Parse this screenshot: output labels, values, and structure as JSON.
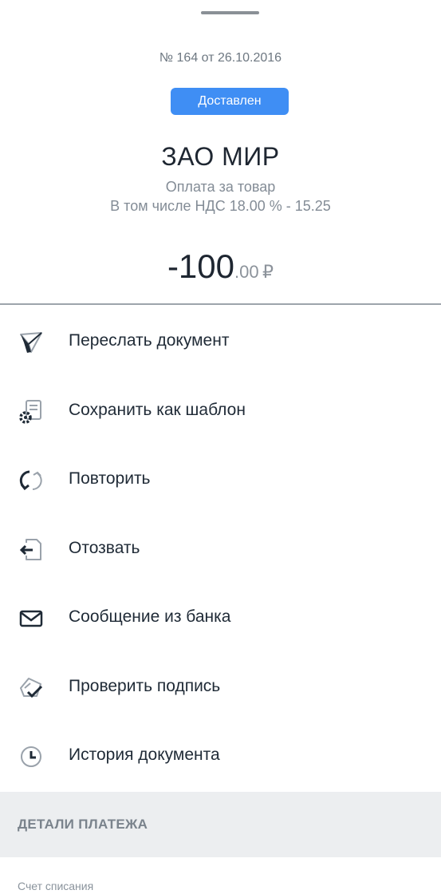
{
  "document": {
    "number_line": "№ 164 от 26.10.2016",
    "status": "Доставлен",
    "company": "ЗАО МИР",
    "purpose": "Оплата за товар",
    "vat": "В том числе НДС 18.00 % - 15.25",
    "amount": {
      "integer": "-100",
      "fraction": ".00",
      "currency": "₽"
    }
  },
  "actions": [
    {
      "label": "Переслать документ",
      "icon": "send-icon"
    },
    {
      "label": "Сохранить как шаблон",
      "icon": "save-template-icon"
    },
    {
      "label": "Повторить",
      "icon": "repeat-icon"
    },
    {
      "label": "Отозвать",
      "icon": "revoke-icon"
    },
    {
      "label": "Сообщение из банка",
      "icon": "mail-icon"
    },
    {
      "label": "Проверить подпись",
      "icon": "verify-signature-icon"
    },
    {
      "label": "История документа",
      "icon": "history-icon"
    }
  ],
  "details": {
    "section_title": "ДЕТАЛИ ПЛАТЕЖА",
    "debit_account_label": "Счет списания"
  },
  "colors": {
    "accent": "#3f8ef4",
    "icon_dark": "#1f2a36",
    "icon_light": "#9aa2ab"
  }
}
